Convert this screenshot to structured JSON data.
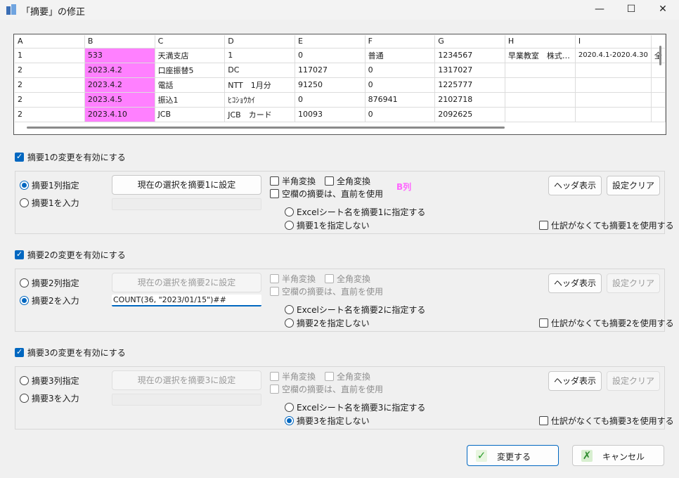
{
  "window": {
    "title": "「摘要」の修正",
    "minimize_glyph": "—",
    "maximize_glyph": "☐",
    "close_glyph": "✕"
  },
  "grid": {
    "columns": [
      "A",
      "B",
      "C",
      "D",
      "E",
      "F",
      "G",
      "H",
      "I"
    ],
    "rows": [
      [
        "1",
        "533",
        "天満支店",
        "1",
        "0",
        "普通",
        "1234567",
        "早業教室　株式…",
        "2020.4.1-2020.4.30"
      ],
      [
        "2",
        "2023.4.2",
        "口座振替5",
        "DC",
        "117027",
        "0",
        "1317027",
        "",
        ""
      ],
      [
        "2",
        "2023.4.2",
        "電話",
        "NTT　1月分",
        "91250",
        "0",
        "1225777",
        "",
        ""
      ],
      [
        "2",
        "2023.4.5",
        "振込1",
        "ﾋｺｼｮｳｶｲ",
        "0",
        "876941",
        "2102718",
        "",
        ""
      ],
      [
        "2",
        "2023.4.10",
        "JCB",
        "JCB　カード",
        "10093",
        "0",
        "2092625",
        "",
        ""
      ]
    ],
    "overflow_cell": "全"
  },
  "sections": [
    {
      "enable_label": "摘要1の変更を有効にする",
      "col_radio": "摘要1列指定",
      "input_radio": "摘要1を入力",
      "set_button": "現在の選択を摘要1に設定",
      "input_value": "",
      "hankaku": "半角変換",
      "zenkaku": "全角変換",
      "blank_label": "空欄の摘要は、直前を使用",
      "col_indicator": "B列",
      "excel_radio": "Excelシート名を摘要1に指定する",
      "none_radio": "摘要1を指定しない",
      "header_button": "ヘッダ表示",
      "clear_button": "設定クリア",
      "always_label": "仕訳がなくても摘要1を使用する"
    },
    {
      "enable_label": "摘要2の変更を有効にする",
      "col_radio": "摘要2列指定",
      "input_radio": "摘要2を入力",
      "set_button": "現在の選択を摘要2に設定",
      "input_value": "COUNT(36, \"2023/01/15\")##",
      "hankaku": "半角変換",
      "zenkaku": "全角変換",
      "blank_label": "空欄の摘要は、直前を使用",
      "col_indicator": "",
      "excel_radio": "Excelシート名を摘要2に指定する",
      "none_radio": "摘要2を指定しない",
      "header_button": "ヘッダ表示",
      "clear_button": "設定クリア",
      "always_label": "仕訳がなくても摘要2を使用する"
    },
    {
      "enable_label": "摘要3の変更を有効にする",
      "col_radio": "摘要3列指定",
      "input_radio": "摘要3を入力",
      "set_button": "現在の選択を摘要3に設定",
      "input_value": "",
      "hankaku": "半角変換",
      "zenkaku": "全角変換",
      "blank_label": "空欄の摘要は、直前を使用",
      "col_indicator": "",
      "excel_radio": "Excelシート名を摘要3に指定する",
      "none_radio": "摘要3を指定しない",
      "header_button": "ヘッダ表示",
      "clear_button": "設定クリア",
      "always_label": "仕訳がなくても摘要3を使用する"
    }
  ],
  "footer": {
    "ok_label": "変更する",
    "cancel_label": "キャンセル"
  },
  "colors": {
    "accent": "#0067c0",
    "highlight_column": "#ff80ff",
    "column_indicator": "#ff66ff"
  }
}
